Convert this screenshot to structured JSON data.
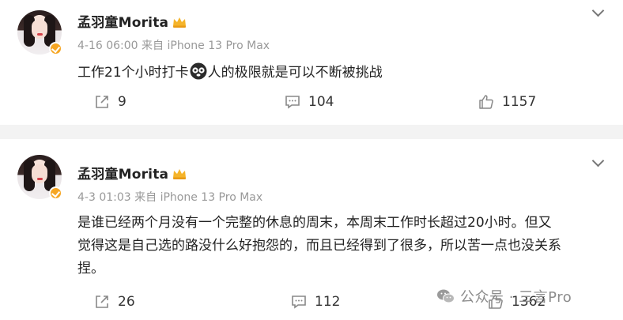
{
  "posts": [
    {
      "author": "孟羽童Morita",
      "time": "4-16 06:00",
      "source": "来自 iPhone 13 Pro Max",
      "text_before_emoji": "工作21个小时打卡",
      "text_after_emoji": "人的极限就是可以不断被挑战",
      "reposts": "9",
      "comments": "104",
      "likes": "1157"
    },
    {
      "author": "孟羽童Morita",
      "time": "4-3 01:03",
      "source": "来自 iPhone 13 Pro Max",
      "text_line1": "是谁已经两个月没有一个完整的休息的周末，本周末工作时长超过20小时。但又",
      "text_line2": "觉得这是自己选的路没什么好抱怨的，而且已经得到了很多，所以苦一点也没关系",
      "text_line3": "捏。",
      "reposts": "26",
      "comments": "112",
      "likes": "1362"
    }
  ],
  "watermark": "公众号 · 三言Pro",
  "colors": {
    "meta": "#999999",
    "badge": "#f6a623",
    "text": "#222222"
  }
}
